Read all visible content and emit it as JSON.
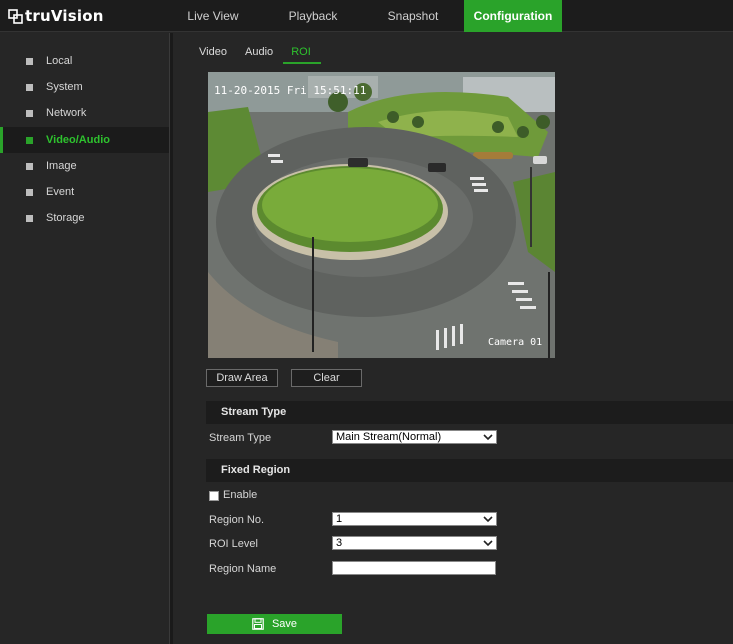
{
  "app": {
    "logo_text": "truVision"
  },
  "top_nav": {
    "live_view": "Live View",
    "playback": "Playback",
    "snapshot": "Snapshot",
    "configuration": "Configuration"
  },
  "sidebar": {
    "items": [
      {
        "label": "Local"
      },
      {
        "label": "System"
      },
      {
        "label": "Network"
      },
      {
        "label": "Video/Audio"
      },
      {
        "label": "Image"
      },
      {
        "label": "Event"
      },
      {
        "label": "Storage"
      }
    ],
    "active": "Video/Audio"
  },
  "sub_tabs": {
    "video": "Video",
    "audio": "Audio",
    "roi": "ROI",
    "active": "ROI"
  },
  "video_overlay": {
    "timestamp": "11-20-2015 Fri 15:51:11",
    "camera_name": "Camera 01"
  },
  "buttons": {
    "draw_area": "Draw Area",
    "clear": "Clear",
    "save": "Save"
  },
  "stream_type_section": {
    "header": "Stream Type",
    "label": "Stream Type",
    "value": "Main Stream(Normal)"
  },
  "fixed_region_section": {
    "header": "Fixed Region",
    "enable_label": "Enable",
    "enable_checked": false,
    "region_no_label": "Region No.",
    "region_no_value": "1",
    "roi_level_label": "ROI Level",
    "roi_level_value": "3",
    "region_name_label": "Region Name",
    "region_name_value": ""
  },
  "colors": {
    "accent": "#2aa32a",
    "background": "#262626",
    "header_bar": "#1c1c1c"
  },
  "icons": {
    "save": "floppy-disk-icon",
    "dropdown": "chevron-down-icon",
    "logo": "truvision-logo-icon"
  }
}
